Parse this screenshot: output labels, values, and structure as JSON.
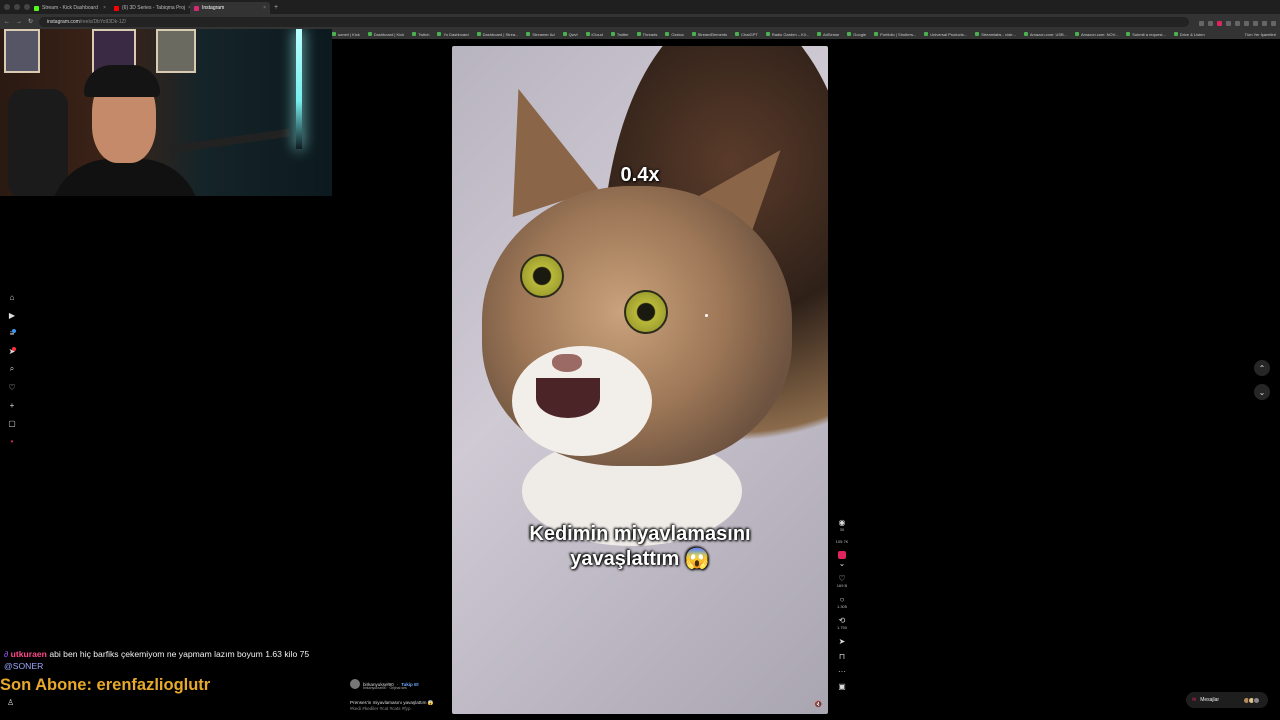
{
  "browser": {
    "tabs": [
      {
        "label": "Stream - Kick Dashboard",
        "favicon_color": "#53fc18",
        "active": false
      },
      {
        "label": "(6) 3D Series - Tabiqma Proj",
        "favicon_color": "#ff0000",
        "active": false
      },
      {
        "label": "Instagram",
        "favicon_color": "#d62976",
        "active": true
      }
    ],
    "new_tab_glyph": "+",
    "url_host": "instagram.com",
    "url_path": "/reels/DbYo93Dk-1Z/",
    "bookmarks": [
      "sonerl | Kick",
      "Dashboard | Kick",
      "Twitch",
      "Yo Dashboard",
      "Dashboard | Strea...",
      "Streamer Ad",
      "Qwvl",
      "iCloud",
      "Twitter",
      "Threads",
      "Ozzica",
      "StreamElements",
      "ChatGPT",
      "Radio Garden – Kli...",
      "AdSense",
      "Google",
      "Portfolio | Shutters...",
      "Universal Products...",
      "Streamlabs - víde...",
      "Amazon.com: USB...",
      "Amazon.com: NOV...",
      "Submit a request...",
      "Drive & Listen"
    ],
    "bookmarks_right": "Tüm Yer İşaretleri"
  },
  "left_rail": {
    "icons": [
      "home-icon",
      "reels-icon",
      "menu-icon",
      "explore-icon",
      "search-icon",
      "heart-icon",
      "create-icon",
      "messages-box-icon",
      "more-icon"
    ]
  },
  "chat": {
    "user": "utkuraen",
    "message": "abi ben hiç barfiks çekemiyom ne yapmam lazım boyum 1.63 kilo 75",
    "mention": "@SONER",
    "subscriber_banner": "Son Abone: erenfazlioglutr"
  },
  "reel": {
    "speed_overlay": "0.4x",
    "caption_line1": "Kedimin miyavlamasını",
    "caption_line2": "yavaşlattım 😱",
    "author": "birkanyuksel90",
    "follow_label": "Takip Et",
    "audio": "birkanyuksel90 · Orijinal ses",
    "description": "Prenses'in miyavlamasını yavaşlattım 😱",
    "hashtags": "#kedi #kediler #cat #cats #fyp",
    "corner_badge": "🔇"
  },
  "actions": {
    "top_count": "30",
    "mid_label": "105.7K",
    "likes": "169 B",
    "comments": "1.305",
    "reposts": "1.750"
  },
  "messages": {
    "label": "Mesajlar"
  },
  "colors": {
    "accent_pink": "#e0245e",
    "subscriber_gold": "#e7a92b",
    "chat_user": "#ff4a8a"
  }
}
